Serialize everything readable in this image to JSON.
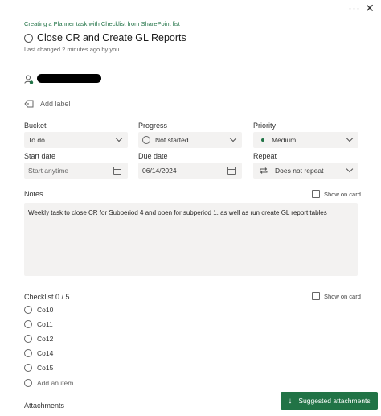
{
  "header": {
    "more_icon": "more-horizontal-icon",
    "more_glyph": "···",
    "close_icon": "close-icon",
    "close_glyph": "✕"
  },
  "breadcrumb": "Creating a Planner task with Checklist from SharePoint list",
  "task": {
    "title": "Close CR and Create GL Reports",
    "last_changed": "Last changed 2 minutes ago by you"
  },
  "labels": {
    "add_label": "Add label"
  },
  "fields": {
    "bucket": {
      "label": "Bucket",
      "value": "To do"
    },
    "progress": {
      "label": "Progress",
      "value": "Not started"
    },
    "priority": {
      "label": "Priority",
      "value": "Medium"
    },
    "start_date": {
      "label": "Start date",
      "placeholder": "Start anytime"
    },
    "due_date": {
      "label": "Due date",
      "value": "06/14/2024"
    },
    "repeat": {
      "label": "Repeat",
      "value": "Does not repeat"
    }
  },
  "notes": {
    "label": "Notes",
    "show_on_card": "Show on card",
    "text": "Weekly task to close CR for Subperiod 4 and open for subperiod 1. as well as run create GL report tables"
  },
  "checklist": {
    "label": "Checklist 0 / 5",
    "show_on_card": "Show on card",
    "items": [
      "Co10",
      "Co11",
      "Co12",
      "Co14",
      "Co15"
    ],
    "add_item": "Add an item"
  },
  "attachments": {
    "label": "Attachments",
    "suggested_button": "Suggested attachments"
  },
  "colors": {
    "accent": "#217346",
    "field_bg": "#f3f2f1"
  }
}
